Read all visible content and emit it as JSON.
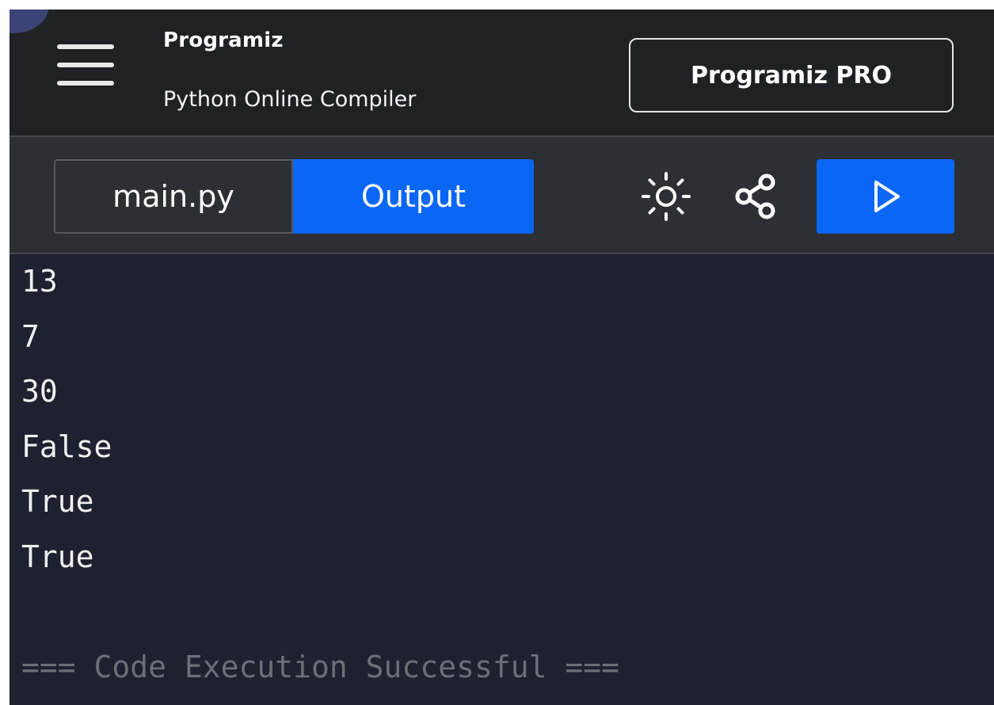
{
  "header": {
    "brand_name": "Programiz",
    "subtitle": "Python Online Compiler",
    "pro_button_label": "Programiz PRO"
  },
  "toolbar": {
    "tabs": [
      {
        "label": "main.py",
        "active": false
      },
      {
        "label": "Output",
        "active": true
      }
    ],
    "icons": [
      "theme-toggle-icon",
      "share-icon",
      "run-icon"
    ]
  },
  "output": {
    "lines": [
      "13",
      "7",
      "30",
      "False",
      "True",
      "True"
    ],
    "status": "=== Code Execution Successful ==="
  },
  "colors": {
    "header_bg": "#202124",
    "toolbar_bg": "#2d2f34",
    "output_bg": "#1d2130",
    "accent": "#0a66f5",
    "status_text": "#6c6f78"
  }
}
